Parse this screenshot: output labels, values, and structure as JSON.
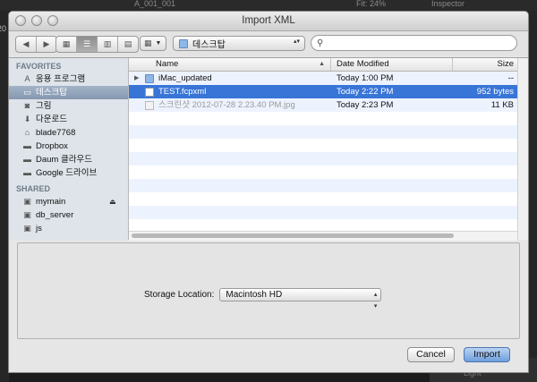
{
  "window": {
    "title": "Import XML"
  },
  "background": {
    "top_text": "A_001_001",
    "fit_text": "Fit: 24%",
    "inspector": "Inspector",
    "left_fragment": "20",
    "light_label": "Light"
  },
  "toolbar": {
    "location": "데스크탑"
  },
  "sidebar": {
    "favorites_header": "FAVORITES",
    "favorites": [
      {
        "label": "응용 프로그램",
        "icon": "applications-icon"
      },
      {
        "label": "데스크탑",
        "icon": "desktop-icon",
        "selected": true
      },
      {
        "label": "그림",
        "icon": "pictures-icon"
      },
      {
        "label": "다운로드",
        "icon": "downloads-icon"
      },
      {
        "label": "blade7768",
        "icon": "home-icon"
      },
      {
        "label": "Dropbox",
        "icon": "folder-icon"
      },
      {
        "label": "Daum 클라우드",
        "icon": "folder-icon"
      },
      {
        "label": "Google 드라이브",
        "icon": "folder-icon"
      }
    ],
    "shared_header": "SHARED",
    "shared": [
      {
        "label": "mymain",
        "icon": "computer-icon"
      },
      {
        "label": "db_server",
        "icon": "computer-icon"
      },
      {
        "label": "js",
        "icon": "computer-icon"
      }
    ]
  },
  "columns": {
    "name": "Name",
    "date": "Date Modified",
    "size": "Size"
  },
  "files": [
    {
      "name": "iMac_updated",
      "date": "Today 1:00 PM",
      "size": "--",
      "kind": "folder"
    },
    {
      "name": "TEST.fcpxml",
      "date": "Today 2:22 PM",
      "size": "952 bytes",
      "kind": "doc",
      "selected": true
    },
    {
      "name": "스크린샷 2012-07-28 2.23.40 PM.jpg",
      "date": "Today 2:23 PM",
      "size": "11 KB",
      "kind": "image",
      "dimmed": true
    }
  ],
  "storage": {
    "label": "Storage Location:",
    "value": "Macintosh HD"
  },
  "buttons": {
    "cancel": "Cancel",
    "import": "Import"
  }
}
